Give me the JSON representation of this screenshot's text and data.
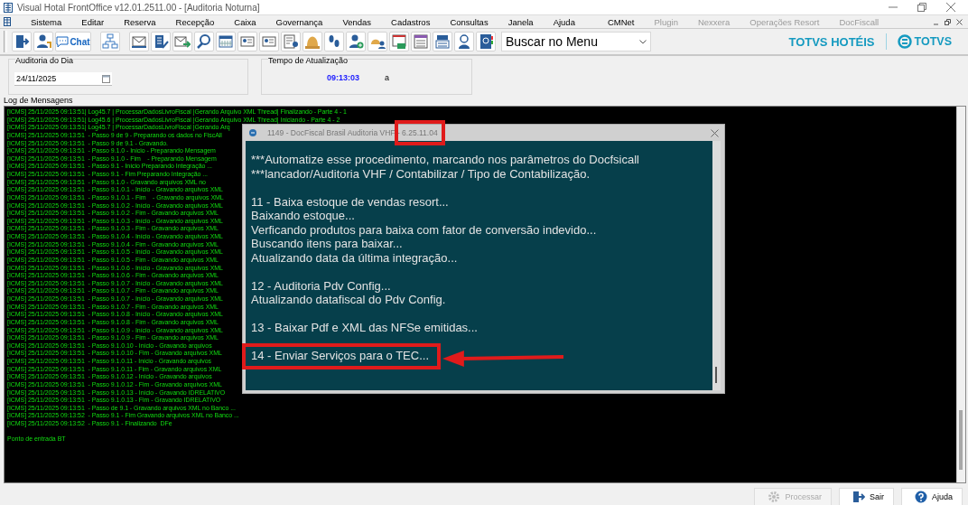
{
  "window": {
    "title": "Visual Hotal FrontOffice v12.01.2511.00 - [Auditoria Noturna]"
  },
  "menu": [
    {
      "label": "Sistema",
      "disabled": false
    },
    {
      "label": "Editar",
      "disabled": false
    },
    {
      "label": "Reserva",
      "disabled": false
    },
    {
      "label": "Recepção",
      "disabled": false
    },
    {
      "label": "Caixa",
      "disabled": false
    },
    {
      "label": "Governança",
      "disabled": false
    },
    {
      "label": "Vendas",
      "disabled": false
    },
    {
      "label": "Cadastros",
      "disabled": false
    },
    {
      "label": "Consultas",
      "disabled": false
    },
    {
      "label": "Janela",
      "disabled": false
    },
    {
      "label": "Ajuda",
      "disabled": false
    },
    {
      "label": "CMNet",
      "disabled": false
    },
    {
      "label": "Plugin",
      "disabled": true
    },
    {
      "label": "Nexxera",
      "disabled": true
    },
    {
      "label": "Operações Resort",
      "disabled": true
    },
    {
      "label": "DocFiscall",
      "disabled": true
    }
  ],
  "toolbar": {
    "chat_label": "Chat",
    "search": {
      "value": "Buscar no Menu"
    },
    "brand": "TOTVS HOTÉIS",
    "logo_text": "TOTVS"
  },
  "audit_day": {
    "label": "Auditoria do Dia",
    "date": "24/11/2025"
  },
  "refresh_time": {
    "label": "Tempo de Atualização",
    "time": "09:13:03",
    "suffix": "a"
  },
  "log": {
    "label": "Log de Mensagens",
    "lines": [
      "[ICMS] 25/11/2025 09:13:51| Log45.7 | ProcessarDadosLivroFiscal |Gerando Arquivo XML Thread| Finalizando - Parte 4 - 1",
      "[ICMS] 25/11/2025 09:13:51| Log45.6 | ProcessarDadosLivroFiscal |Gerando Arquivo XML Thread| Iniciando - Parte 4 - 2",
      "[ICMS] 25/11/2025 09:13:51| Log45.7 | ProcessarDadosLivroFiscal |Gerando Arq",
      "[ICMS] 25/11/2025 09:13:51  - Passo 9 de 9 - Preparando os dados no FiscAll",
      "[ICMS] 25/11/2025 09:13:51  - Passo 9 de 9.1 - Gravando.",
      "[ICMS] 25/11/2025 09:13:51  - Passo 9.1.0 - Início - Preparando Mensagem",
      "[ICMS] 25/11/2025 09:13:51  - Passo 9.1.0 - Fim    - Preparando Mensagem",
      "[ICMS] 25/11/2025 09:13:51  - Passo 9.1 - Início Preparando Integração ...",
      "[ICMS] 25/11/2025 09:13:51  - Passo 9.1 - Fim Preparando Integração ...",
      "[ICMS] 25/11/2025 09:13:51  - Passo 9.1.0 - Gravando arquivos XML no",
      "[ICMS] 25/11/2025 09:13:51  - Passo 9.1.0.1 - Início - Gravando arquivos XML",
      "[ICMS] 25/11/2025 09:13:51  - Passo 9.1.0.1 - Fim    - Gravando arquivos XML",
      "[ICMS] 25/11/2025 09:13:51  - Passo 9.1.0.2 - Início - Gravando arquivos XML",
      "[ICMS] 25/11/2025 09:13:51  - Passo 9.1.0.2 - Fim - Gravando arquivos XML",
      "[ICMS] 25/11/2025 09:13:51  - Passo 9.1.0.3 - Início - Gravando arquivos XML",
      "[ICMS] 25/11/2025 09:13:51  - Passo 9.1.0.3 - Fim - Gravando arquivos XML",
      "[ICMS] 25/11/2025 09:13:51  - Passo 9.1.0.4 - Início - Gravando arquivos XML",
      "[ICMS] 25/11/2025 09:13:51  - Passo 9.1.0.4 - Fim - Gravando arquivos XML",
      "[ICMS] 25/11/2025 09:13:51  - Passo 9.1.0.5 - Início - Gravando arquivos XML",
      "[ICMS] 25/11/2025 09:13:51  - Passo 9.1.0.5 - Fim - Gravando arquivos XML",
      "[ICMS] 25/11/2025 09:13:51  - Passo 9.1.0.6 - Início - Gravando arquivos XML",
      "[ICMS] 25/11/2025 09:13:51  - Passo 9.1.0.6 - Fim - Gravando arquivos XML",
      "[ICMS] 25/11/2025 09:13:51  - Passo 9.1.0.7 - Início - Gravando arquivos XML",
      "[ICMS] 25/11/2025 09:13:51  - Passo 9.1.0.7 - Fim - Gravando arquivos XML",
      "[ICMS] 25/11/2025 09:13:51  - Passo 9.1.0.7 - Início - Gravando arquivos XML",
      "[ICMS] 25/11/2025 09:13:51  - Passo 9.1.0.7 - Fim - Gravando arquivos XML",
      "[ICMS] 25/11/2025 09:13:51  - Passo 9.1.0.8 - Início - Gravando arquivos XML",
      "[ICMS] 25/11/2025 09:13:51  - Passo 9.1.0.8 - Fim - Gravando arquivos XML",
      "[ICMS] 25/11/2025 09:13:51  - Passo 9.1.0.9 - Início - Gravando arquivos XML",
      "[ICMS] 25/11/2025 09:13:51  - Passo 9.1.0.9 - Fim - Gravando arquivos XML",
      "[ICMS] 25/11/2025 09:13:51  - Passo 9.1.0.10 - Início - Gravando arquivos",
      "[ICMS] 25/11/2025 09:13:51  - Passo 9.1.0.10 - Fim - Gravando arquivos XML",
      "[ICMS] 25/11/2025 09:13:51  - Passo 9.1.0.11 - Início - Gravando arquivos",
      "[ICMS] 25/11/2025 09:13:51  - Passo 9.1.0.11 - Fim - Gravando arquivos XML",
      "[ICMS] 25/11/2025 09:13:51  - Passo 9.1.0.12 - Início - Gravando arquivos",
      "[ICMS] 25/11/2025 09:13:51  - Passo 9.1.0.12 - Fim - Gravando arquivos XML",
      "[ICMS] 25/11/2025 09:13:51  - Passo 9.1.0.13 - Início - Gravando IDRELATIVO",
      "[ICMS] 25/11/2025 09:13:51  - Passo 9.1.0.13 - Fim - Gravando IDRELATIVO",
      "[ICMS] 25/11/2025 09:13:51  - Passo de 9.1 - Gravando arquivos XML no Banco ...",
      "[ICMS] 25/11/2025 09:13:52  - Passo 9.1 - Fim Gravando arquivos XML no Banco ...",
      "[ICMS] 25/11/2025 09:13:52  - Passo 9.1 - Finalizando  DFe"
    ],
    "footer": "Ponto de entrada BT"
  },
  "dialog": {
    "title": "1149 - DocFiscal Brasil Auditoria VHF - 6.25.11.04",
    "paragraphs": [
      [
        "***Automatize esse procedimento, marcando nos parâmetros do Docfsicall",
        "***lancador/Auditoria VHF / Contabilizar / Tipo de Contabilização."
      ],
      [
        "11 - Baixa estoque de vendas resort...",
        "Baixando estoque...",
        "Verficando produtos para baixa com fator de conversão indevido...",
        "Buscando itens para baixar...",
        "Atualizando data da última integração..."
      ],
      [
        "12 - Auditoria Pdv Config...",
        "Atualizando datafiscal do Pdv Config."
      ],
      [
        "13 - Baixar Pdf e XML das NFSe emitidas..."
      ],
      [
        "14 - Enviar Serviços para o TEC..."
      ]
    ]
  },
  "buttons": [
    {
      "label": "Processar",
      "disabled": true
    },
    {
      "label": "Sair",
      "disabled": false
    },
    {
      "label": "Ajuda",
      "disabled": false
    }
  ]
}
